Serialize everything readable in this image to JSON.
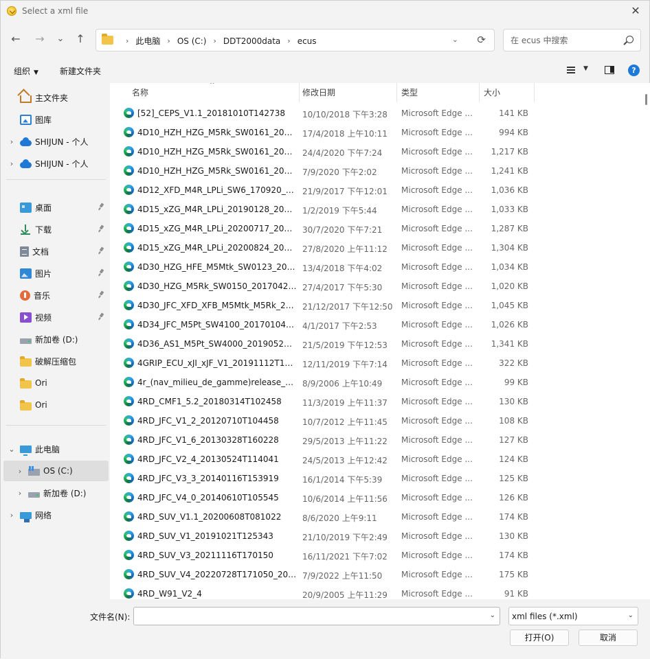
{
  "window": {
    "title": "Select a xml file",
    "close_glyph": "✕"
  },
  "nav": {
    "back": "←",
    "forward": "→",
    "recent": "⌄",
    "up": "↑",
    "breadcrumbs": [
      "此电脑",
      "OS (C:)",
      "DDT2000data",
      "ecus"
    ],
    "dropdown": "⌄",
    "refresh": "⟳"
  },
  "search": {
    "placeholder": "在 ecus 中搜索",
    "icon": "search-icon"
  },
  "toolbar": {
    "organize": "组织",
    "new_folder": "新建文件夹",
    "help": "?"
  },
  "sidebar": {
    "items": [
      {
        "label": "主文件夹",
        "icon": "home-icon",
        "chevron": ""
      },
      {
        "label": "图库",
        "icon": "gallery-icon",
        "chevron": ""
      },
      {
        "label": "SHIJUN - 个人",
        "icon": "cloud-icon",
        "chevron": "›"
      },
      {
        "label": "SHIJUN - 个人",
        "icon": "cloud-icon",
        "chevron": "›"
      },
      {
        "label": "桌面",
        "icon": "desktop-icon",
        "chevron": "",
        "pinned": true
      },
      {
        "label": "下载",
        "icon": "download-icon",
        "chevron": "",
        "pinned": true
      },
      {
        "label": "文档",
        "icon": "document-icon",
        "chevron": "",
        "pinned": true
      },
      {
        "label": "图片",
        "icon": "pictures-icon",
        "chevron": "",
        "pinned": true
      },
      {
        "label": "音乐",
        "icon": "music-icon",
        "chevron": "",
        "pinned": true
      },
      {
        "label": "视频",
        "icon": "video-icon",
        "chevron": "",
        "pinned": true
      },
      {
        "label": "新加卷 (D:)",
        "icon": "drive-icon",
        "chevron": ""
      },
      {
        "label": "破解压缩包",
        "icon": "folder-icon",
        "chevron": ""
      },
      {
        "label": "Ori",
        "icon": "folder-icon",
        "chevron": ""
      },
      {
        "label": "Ori",
        "icon": "folder-icon",
        "chevron": ""
      },
      {
        "label": "此电脑",
        "icon": "pc-icon",
        "chevron": "⌄"
      },
      {
        "label": "OS (C:)",
        "icon": "os-drive-icon",
        "chevron": "›",
        "selected": true
      },
      {
        "label": "新加卷 (D:)",
        "icon": "drive-icon",
        "chevron": "›"
      },
      {
        "label": "网络",
        "icon": "network-icon",
        "chevron": "›"
      }
    ]
  },
  "columns": {
    "name": "名称",
    "date": "修改日期",
    "type": "类型",
    "size": "大小",
    "sort_glyph": "^"
  },
  "files": [
    {
      "name": "[52]_CEPS_V1.1_20181010T142738",
      "date": "10/10/2018 下午3:28",
      "type": "Microsoft Edge ...",
      "size": "141 KB"
    },
    {
      "name": "4D10_HZH_HZG_M5Rk_SW0161_2017...",
      "date": "17/4/2018 上午10:11",
      "type": "Microsoft Edge ...",
      "size": "994 KB"
    },
    {
      "name": "4D10_HZH_HZG_M5Rk_SW0161_2020...",
      "date": "24/4/2020 下午7:24",
      "type": "Microsoft Edge ...",
      "size": "1,217 KB"
    },
    {
      "name": "4D10_HZH_HZG_M5Rk_SW0161_2020...",
      "date": "7/9/2020 下午2:02",
      "type": "Microsoft Edge ...",
      "size": "1,241 KB"
    },
    {
      "name": "4D12_XFD_M4R_LPLi_SW6_170920_20...",
      "date": "21/9/2017 下午12:01",
      "type": "Microsoft Edge ...",
      "size": "1,036 KB"
    },
    {
      "name": "4D15_xZG_M4R_LPLi_20190128_20190...",
      "date": "1/2/2019 下午5:44",
      "type": "Microsoft Edge ...",
      "size": "1,033 KB"
    },
    {
      "name": "4D15_xZG_M4R_LPLi_20200717_20200...",
      "date": "30/7/2020 下午7:21",
      "type": "Microsoft Edge ...",
      "size": "1,287 KB"
    },
    {
      "name": "4D15_xZG_M4R_LPLi_20200824_20200...",
      "date": "27/8/2020 上午11:12",
      "type": "Microsoft Edge ...",
      "size": "1,304 KB"
    },
    {
      "name": "4D30_HZG_HFE_M5Mtk_SW0123_201...",
      "date": "13/4/2018 下午4:02",
      "type": "Microsoft Edge ...",
      "size": "1,034 KB"
    },
    {
      "name": "4D30_HZG_M5Rk_SW0150_20170427_...",
      "date": "27/4/2017 下午5:30",
      "type": "Microsoft Edge ...",
      "size": "1,020 KB"
    },
    {
      "name": "4D30_JFC_XFD_XFB_M5Mtk_M5Rk_20...",
      "date": "21/12/2017 下午12:50",
      "type": "Microsoft Edge ...",
      "size": "1,045 KB"
    },
    {
      "name": "4D34_JFC_M5Pt_SW4100_20170104_2...",
      "date": "4/1/2017 下午2:53",
      "type": "Microsoft Edge ...",
      "size": "1,026 KB"
    },
    {
      "name": "4D36_AS1_M5Pt_SW4000_201905201_...",
      "date": "21/5/2019 下午12:53",
      "type": "Microsoft Edge ...",
      "size": "1,341 KB"
    },
    {
      "name": "4GRIP_ECU_xJI_xJF_V1_20191112T171...",
      "date": "12/11/2019 下午7:14",
      "type": "Microsoft Edge ...",
      "size": "322 KB"
    },
    {
      "name": "4r_(nav_milieu_de_gamme)release_bd...",
      "date": "8/9/2006 上午10:49",
      "type": "Microsoft Edge ...",
      "size": "99 KB"
    },
    {
      "name": "4RD_CMF1_5.2_20180314T102458",
      "date": "11/3/2019 上午11:37",
      "type": "Microsoft Edge ...",
      "size": "130 KB"
    },
    {
      "name": "4RD_JFC_V1_2_20120710T104458",
      "date": "10/7/2012 上午11:45",
      "type": "Microsoft Edge ...",
      "size": "108 KB"
    },
    {
      "name": "4RD_JFC_V1_6_20130328T160228",
      "date": "29/5/2013 上午11:22",
      "type": "Microsoft Edge ...",
      "size": "127 KB"
    },
    {
      "name": "4RD_JFC_V2_4_20130524T114041",
      "date": "24/5/2013 上午12:42",
      "type": "Microsoft Edge ...",
      "size": "124 KB"
    },
    {
      "name": "4RD_JFC_V3_3_20140116T153919",
      "date": "16/1/2014 下午5:39",
      "type": "Microsoft Edge ...",
      "size": "125 KB"
    },
    {
      "name": "4RD_JFC_V4_0_20140610T105545",
      "date": "10/6/2014 上午11:56",
      "type": "Microsoft Edge ...",
      "size": "126 KB"
    },
    {
      "name": "4RD_SUV_V1.1_20200608T081022",
      "date": "8/6/2020 上午9:11",
      "type": "Microsoft Edge ...",
      "size": "174 KB"
    },
    {
      "name": "4RD_SUV_V1_20191021T125343",
      "date": "21/10/2019 下午2:49",
      "type": "Microsoft Edge ...",
      "size": "130 KB"
    },
    {
      "name": "4RD_SUV_V3_20211116T170150",
      "date": "16/11/2021 下午7:02",
      "type": "Microsoft Edge ...",
      "size": "174 KB"
    },
    {
      "name": "4RD_SUV_V4_20220728T171050_2022...",
      "date": "7/9/2022 上午11:50",
      "type": "Microsoft Edge ...",
      "size": "175 KB"
    },
    {
      "name": "4RD_W91_V2_4",
      "date": "20/9/2005 上午11:29",
      "type": "Microsoft Edge ...",
      "size": "91 KB"
    }
  ],
  "footer": {
    "filename_label": "文件名(N):",
    "filename_value": "",
    "filter_value": "xml files (*.xml)",
    "dropdown": "⌄",
    "open_button": "打开(O)",
    "cancel_button": "取消"
  },
  "colors": {
    "accent": "#1e7ad8",
    "selected_bg": "#dedede",
    "folder": "#f2c44a"
  }
}
